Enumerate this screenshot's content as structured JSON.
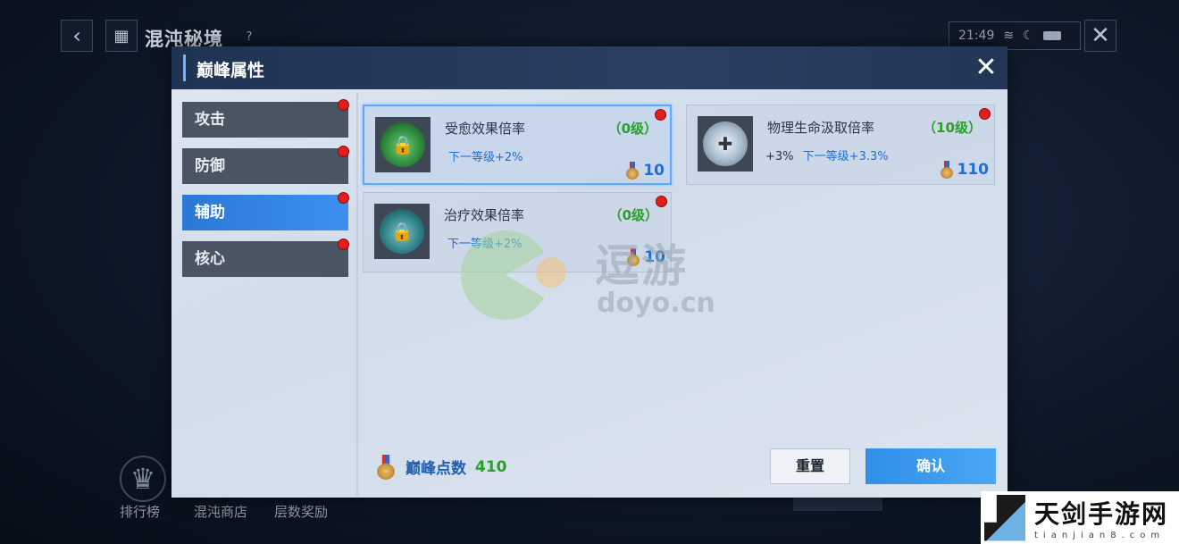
{
  "background": {
    "title": "混沌秘境",
    "help_label": "?",
    "time": "21:49",
    "bottom_nav": [
      {
        "label": "排行榜"
      },
      {
        "label": "混沌商店"
      },
      {
        "label": "层数奖励"
      }
    ]
  },
  "dialog": {
    "title": "巅峰属性",
    "close_label": "✕",
    "tabs": [
      {
        "label": "攻击",
        "has_notice": true,
        "active": false
      },
      {
        "label": "防御",
        "has_notice": true,
        "active": false
      },
      {
        "label": "辅助",
        "has_notice": true,
        "active": true
      },
      {
        "label": "核心",
        "has_notice": true,
        "active": false
      }
    ],
    "cards": [
      {
        "name": "受愈效果倍率",
        "level": "（0级）",
        "current": "",
        "next": "下一等级+2%",
        "cost": "10",
        "selected": true,
        "icon": "heal-lotus-icon"
      },
      {
        "name": "物理生命汲取倍率",
        "level": "（10级）",
        "current": "+3%",
        "next": "下一等级+3.3%",
        "cost": "110",
        "selected": false,
        "icon": "life-drain-icon"
      },
      {
        "name": "治疗效果倍率",
        "level": "（0级）",
        "current": "",
        "next": "下一等级+2%",
        "cost": "10",
        "selected": false,
        "icon": "treatment-icon"
      }
    ],
    "points_label": "巅峰点数",
    "points_value": "410",
    "reset_label": "重置",
    "confirm_label": "确认"
  },
  "watermarks": {
    "doyo_cn": "逗游",
    "doyo_en": "doyo.cn",
    "tianjian_cn": "天剑手游网",
    "tianjian_en": "tianjian8.com"
  },
  "colors": {
    "accent_blue": "#3d8ff0",
    "level_green": "#2aa02a",
    "notice_red": "#e01e1e",
    "header_navy": "#2a3f62"
  }
}
